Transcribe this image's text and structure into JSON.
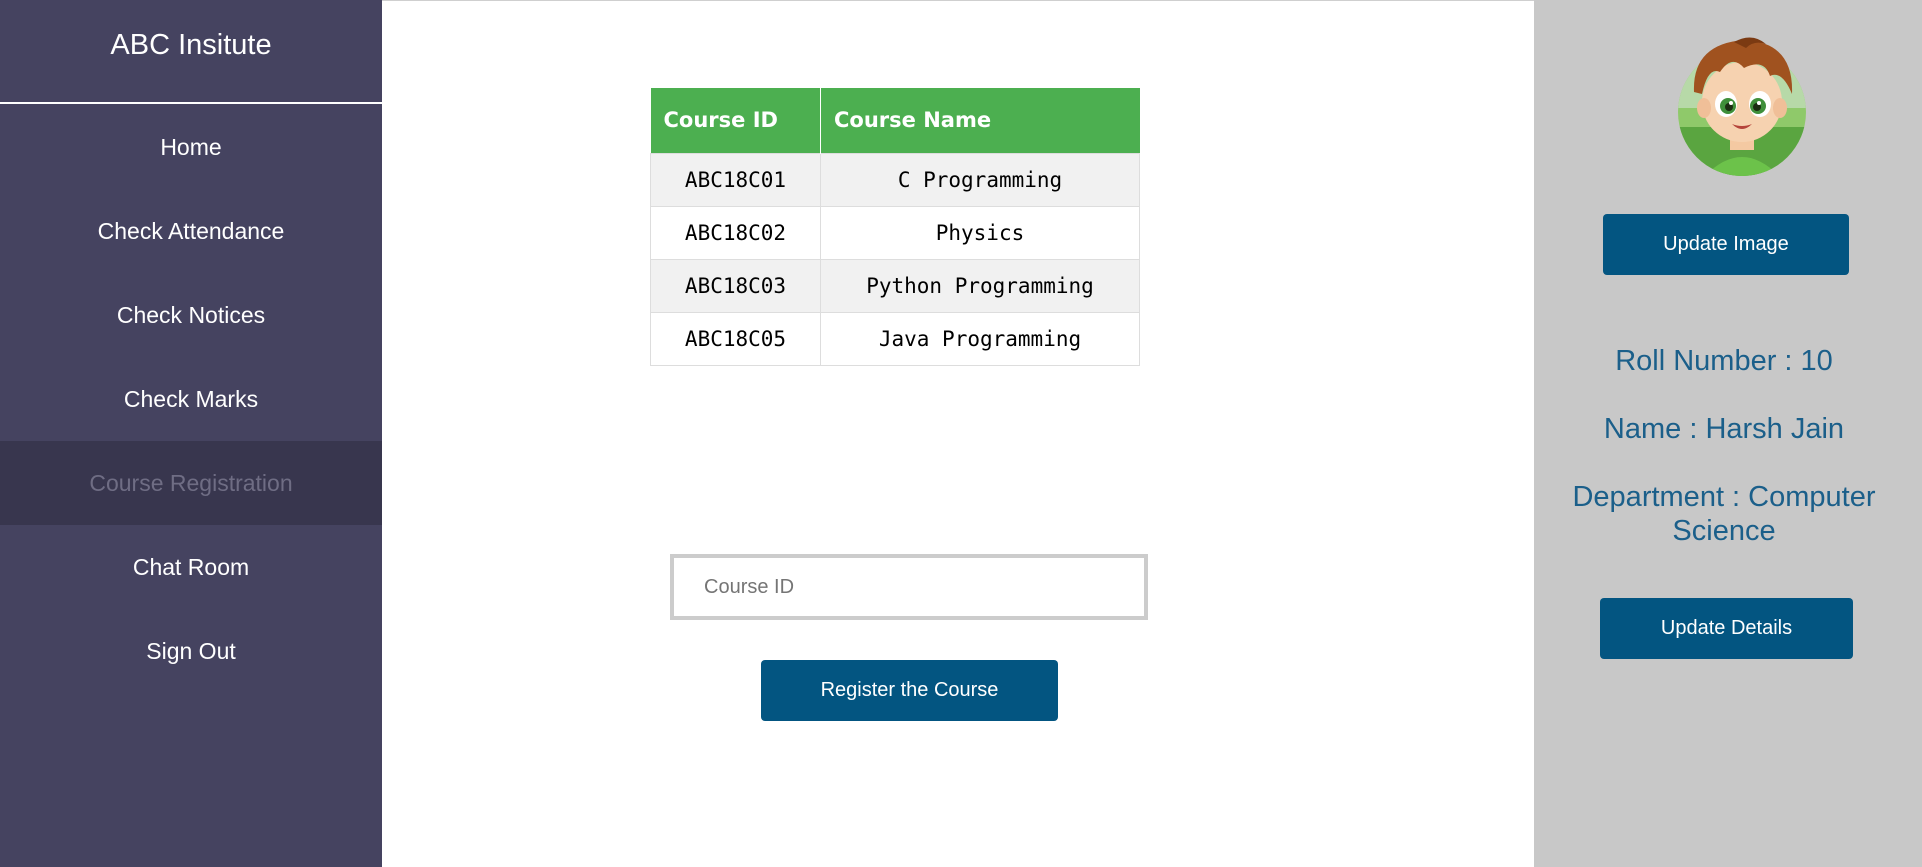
{
  "sidebar": {
    "brand": "ABC Insitute",
    "items": [
      {
        "label": "Home"
      },
      {
        "label": "Check Attendance"
      },
      {
        "label": "Check Notices"
      },
      {
        "label": "Check Marks"
      },
      {
        "label": "Course Registration",
        "active": true
      },
      {
        "label": "Chat Room"
      },
      {
        "label": "Sign Out"
      }
    ]
  },
  "courses": {
    "headers": [
      "Course ID",
      "Course Name"
    ],
    "rows": [
      [
        "ABC18C01",
        "C Programming"
      ],
      [
        "ABC18C02",
        "Physics"
      ],
      [
        "ABC18C03",
        "Python Programming"
      ],
      [
        "ABC18C05",
        "Java Programming"
      ]
    ]
  },
  "registration": {
    "placeholder": "Course ID",
    "value": "",
    "button_label": "Register the Course"
  },
  "profile": {
    "avatar_icon": "cartoon-boy-avatar",
    "update_image_label": "Update Image",
    "roll": "Roll Number : 10",
    "name": "Name : Harsh Jain",
    "department": "Department : Computer Science",
    "update_details_label": "Update Details"
  },
  "colors": {
    "sidebar_bg": "#454360",
    "sidebar_active_bg": "#38364e",
    "table_header": "#4caf50",
    "button": "#035581",
    "profile_bg": "#c8c8c8",
    "profile_text": "#1b5f8a"
  }
}
